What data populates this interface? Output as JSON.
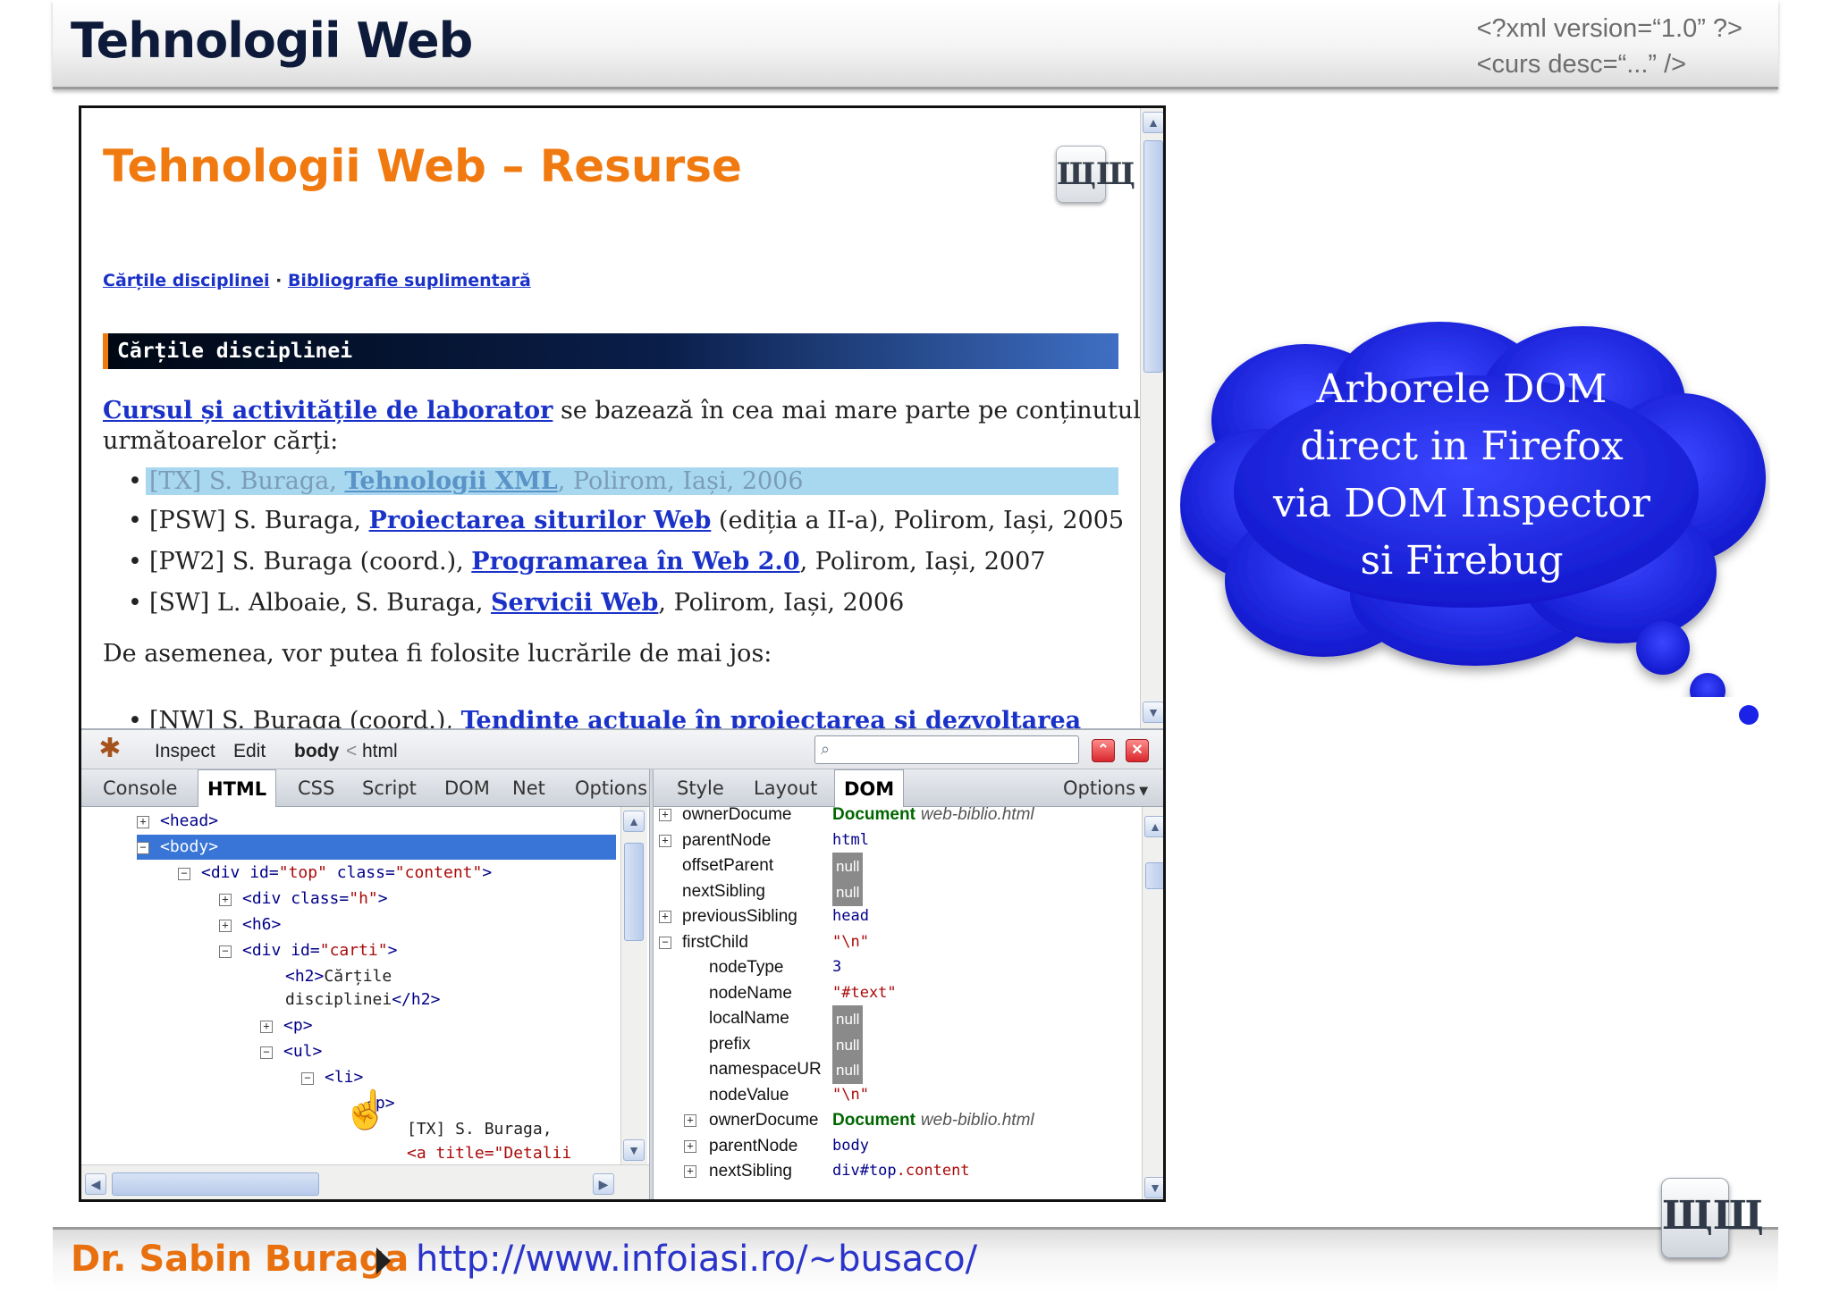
{
  "slide": {
    "title": "Tehnologii Web",
    "xml_decl_line1": "<?xml version=“1.0” ?>",
    "xml_decl_line2": "<curs desc=“...” />",
    "footer_author": "Dr. Sabin Buraga",
    "footer_url": "http://www.infoiasi.ro/~busaco/",
    "logo_text": "ЩЩ"
  },
  "browser_page": {
    "title": "Tehnologii Web – Resurse",
    "link_carti": "Cărțile disciplinei",
    "link_separator": " · ",
    "link_bibliografie": "Bibliografie suplimentară",
    "section_heading": "Cărțile disciplinei",
    "intro_link": "Cursul și activitățile de laborator",
    "intro_rest": " se bazează în cea mai mare parte pe conținutul",
    "intro_line2": "următoarelor cărți:",
    "books": [
      {
        "prefix": "[TX] S. Buraga, ",
        "link": "Tehnologii XML",
        "suffix": ", Polirom, Iași, 2006"
      },
      {
        "prefix": "[PSW] S. Buraga, ",
        "link": "Proiectarea siturilor Web",
        "suffix": " (ediția a II-a), Polirom, Iași, 2005"
      },
      {
        "prefix": "[PW2] S. Buraga (coord.), ",
        "link": "Programarea în Web 2.0",
        "suffix": ", Polirom, Iași, 2007"
      },
      {
        "prefix": "[SW] L. Alboaie, S. Buraga, ",
        "link": "Servicii Web",
        "suffix": ", Polirom, Iași, 2006"
      }
    ],
    "also_text": "De asemenea, vor putea fi folosite lucrările de mai jos:",
    "partial_prefix": "[NW] S. Buraga (coord.), ",
    "partial_link": "Tendințe actuale în proiectarea și dezvoltarea"
  },
  "firebug": {
    "toolbar": {
      "inspect": "Inspect",
      "edit": "Edit",
      "crumb_body": "body",
      "crumb_sep": "<",
      "crumb_html": "html",
      "search_icon": "magnifier-icon"
    },
    "tabs_left": [
      "Console",
      "HTML",
      "CSS",
      "Script",
      "DOM",
      "Net",
      "Options"
    ],
    "active_left": "HTML",
    "tabs_right": [
      "Style",
      "Layout",
      "DOM"
    ],
    "active_right": "DOM",
    "options_right": "Options",
    "tree": [
      {
        "toggle": "+",
        "open": "<",
        "tag": "head",
        "close": ">"
      },
      {
        "toggle": "−",
        "open": "<",
        "tag": "body",
        "close": ">"
      },
      {
        "toggle": "−",
        "tag": "div",
        "a1": "id",
        "v1": "\"top\"",
        "a2": "class",
        "v2": "\"content\""
      },
      {
        "toggle": "+",
        "tag": "div",
        "a1": "class",
        "v1": "\"h\""
      },
      {
        "toggle": "+",
        "tag": "h6"
      },
      {
        "toggle": "−",
        "tag": "div",
        "a1": "id",
        "v1": "\"carti\""
      },
      {
        "tag": "h2",
        "text1": "Cărțile",
        "text2": "disciplinei",
        "endtag": "</h2>"
      },
      {
        "toggle": "+",
        "tag": "p"
      },
      {
        "toggle": "−",
        "tag": "ul"
      },
      {
        "toggle": "−",
        "tag": "li"
      },
      {
        "tag": "p"
      },
      {
        "text": "[TX] S. Buraga,"
      },
      {
        "text": "<a title=\"Detalii"
      }
    ],
    "dom_props": [
      {
        "toggle": "+",
        "name": "ownerDocume",
        "type": "obj",
        "value": "Document",
        "extra": "web-biblio.html"
      },
      {
        "toggle": "+",
        "name": "parentNode",
        "type": "tag",
        "value": "html"
      },
      {
        "name": "offsetParent",
        "type": "null",
        "value": "null"
      },
      {
        "name": "nextSibling",
        "type": "null",
        "value": "null"
      },
      {
        "toggle": "+",
        "name": "previousSibling",
        "type": "tag",
        "value": "head"
      },
      {
        "toggle": "−",
        "name": "firstChild",
        "type": "str",
        "value": "\"\\n\""
      },
      {
        "name": "nodeType",
        "type": "num",
        "value": "3",
        "indent": true
      },
      {
        "name": "nodeName",
        "type": "str",
        "value": "\"#text\"",
        "indent": true
      },
      {
        "name": "localName",
        "type": "null",
        "value": "null",
        "indent": true
      },
      {
        "name": "prefix",
        "type": "null",
        "value": "null",
        "indent": true
      },
      {
        "name": "namespaceUR",
        "type": "null",
        "value": "null",
        "indent": true
      },
      {
        "name": "nodeValue",
        "type": "str",
        "value": "\"\\n\"",
        "indent": true
      },
      {
        "toggle": "+",
        "name": "ownerDocume",
        "type": "obj",
        "value": "Document",
        "extra": "web-biblio.html",
        "indent": true
      },
      {
        "toggle": "+",
        "name": "parentNode",
        "type": "tag",
        "value": "body",
        "indent": true
      },
      {
        "toggle": "+",
        "name": "nextSibling",
        "type": "tag",
        "value": "div#top",
        "extra": ".content",
        "indent": true
      }
    ]
  },
  "cloud": {
    "lines": [
      "Arborele DOM",
      "direct in Firefox",
      "via DOM Inspector",
      "si Firebug"
    ],
    "color": "#1a22e8"
  }
}
